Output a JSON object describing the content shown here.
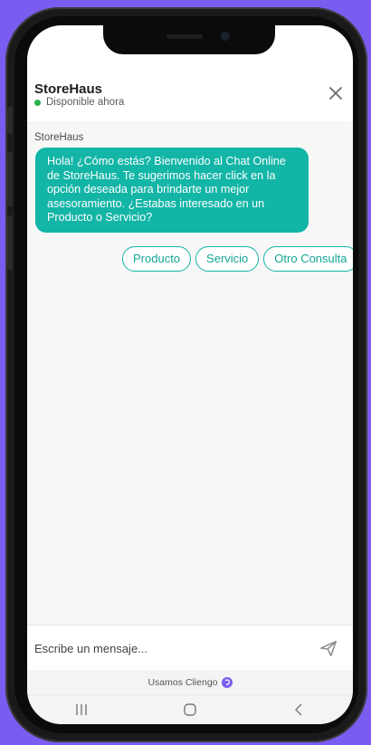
{
  "header": {
    "title": "StoreHaus",
    "status": "Disponible ahora"
  },
  "chat": {
    "sender": "StoreHaus",
    "message": "Hola! ¿Cómo estás? Bienvenido al Chat Online de StoreHaus. Te sugerimos hacer click en la opción deseada para brindarte un mejor asesoramiento. ¿Estabas interesado en un Producto o Servicio?",
    "options": [
      "Producto",
      "Servicio",
      "Otro Consulta"
    ]
  },
  "composer": {
    "placeholder": "Escribe un mensaje..."
  },
  "footer": {
    "powered_by": "Usamos Cliengo"
  },
  "colors": {
    "accent": "#13b5a6",
    "background": "#7b5cf0",
    "online": "#2bb24c"
  },
  "icons": [
    "close-icon",
    "send-icon",
    "cliengo-logo-icon",
    "recents-icon",
    "home-icon",
    "back-icon"
  ]
}
